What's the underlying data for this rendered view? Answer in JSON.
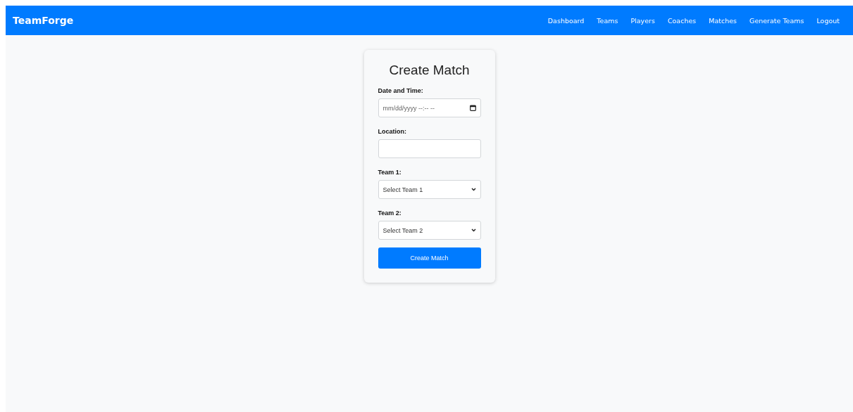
{
  "navbar": {
    "brand": "TeamForge",
    "links": [
      "Dashboard",
      "Teams",
      "Players",
      "Coaches",
      "Matches",
      "Generate Teams",
      "Logout"
    ]
  },
  "form": {
    "title": "Create Match",
    "fields": [
      {
        "kind": "datetime",
        "label": "Date and Time:",
        "placeholder": "mm/dd/yyyy --:-- --"
      },
      {
        "kind": "text",
        "label": "Location:"
      },
      {
        "kind": "select",
        "label": "Team 1:",
        "value": "Select Team 1"
      },
      {
        "kind": "select",
        "label": "Team 2:",
        "value": "Select Team 2"
      }
    ],
    "submit": "Create Match"
  }
}
